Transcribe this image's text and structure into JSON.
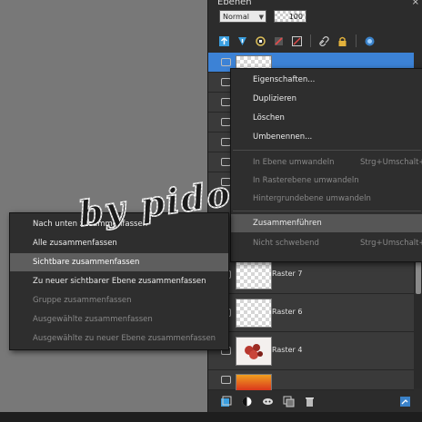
{
  "panel": {
    "title": "Ebenen",
    "close_glyph": "×",
    "blend_mode": "Normal",
    "opacity": "100",
    "toolbar_icons": [
      "new-raster-layer-icon",
      "new-vector-layer-icon",
      "new-group-icon",
      "delete-layer-icon",
      "link-icon",
      "lock-icon",
      "mask-icon"
    ],
    "bottom_icons": [
      "new-layer-icon",
      "adjustment-layer-icon",
      "mask-layer-icon",
      "duplicate-layer-icon",
      "delete-layer-icon",
      "properties-icon"
    ]
  },
  "layers": [
    {
      "name": "Raster 7"
    },
    {
      "name": "Raster 6"
    },
    {
      "name": "Raster 4"
    }
  ],
  "context_menu": {
    "items": [
      {
        "label": "Eigenschaften...",
        "disabled": false
      },
      {
        "label": "Duplizieren",
        "disabled": false
      },
      {
        "label": "Löschen",
        "disabled": false
      },
      {
        "label": "Umbenennen...",
        "disabled": false
      },
      {
        "label": "In Ebene umwandeln",
        "shortcut": "Strg+Umschalt+F",
        "disabled": true
      },
      {
        "label": "In Rasterebene umwandeln",
        "disabled": true
      },
      {
        "label": "Hintergrundebene umwandeln",
        "disabled": true
      },
      {
        "label": "Zusammenführen",
        "disabled": false,
        "highlighted": true
      },
      {
        "label": "Nicht schwebend",
        "shortcut": "Strg+Umschalt+F",
        "disabled": true
      }
    ]
  },
  "submenu": {
    "items": [
      {
        "label": "Nach unten zusammenfassen",
        "disabled": false
      },
      {
        "label": "Alle zusammenfassen",
        "disabled": false
      },
      {
        "label": "Sichtbare zusammenfassen",
        "disabled": false,
        "highlighted": true
      },
      {
        "label": "Zu neuer sichtbarer Ebene zusammenfassen",
        "disabled": false
      },
      {
        "label": "Gruppe zusammenfassen",
        "disabled": true
      },
      {
        "label": "Ausgewählte zusammenfassen",
        "disabled": true
      },
      {
        "label": "Ausgewählte zu neuer Ebene zusammenfassen",
        "disabled": true
      }
    ]
  },
  "signature": {
    "text": "by pido"
  }
}
